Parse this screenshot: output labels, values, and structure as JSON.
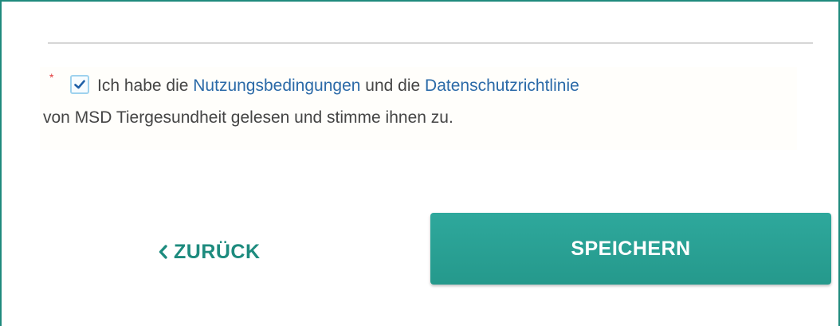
{
  "consent": {
    "required_marker": "*",
    "checked": true,
    "text_part1": "Ich habe die ",
    "terms_link": "Nutzungsbedingungen",
    "text_part2": " und die ",
    "privacy_link": "Datenschutzrichtlinie",
    "text_part3": "von MSD Tiergesundheit gelesen und stimme ihnen zu."
  },
  "actions": {
    "back_label": "ZURÜCK",
    "save_label": "SPEICHERN"
  },
  "colors": {
    "accent": "#25998c",
    "link": "#2b6aa8",
    "required": "#e23b3b"
  },
  "icons": {
    "back": "chevron-left-icon",
    "checkbox": "checkmark-icon"
  }
}
